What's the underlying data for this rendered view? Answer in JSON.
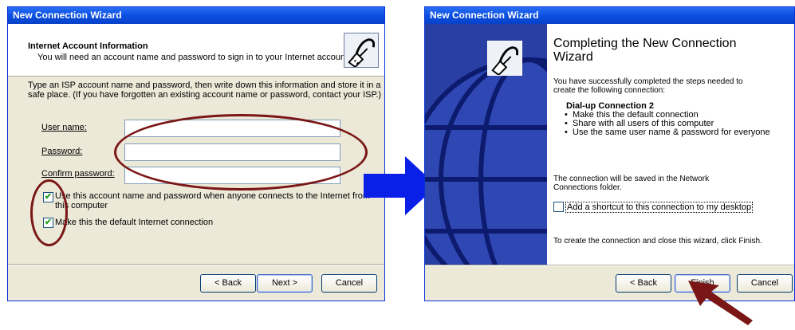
{
  "left_window": {
    "title": "New Connection Wizard",
    "header_title": "Internet Account Information",
    "header_subtitle": "You will need an account name and password to sign in to your Internet account.",
    "intro_line1": "Type an ISP account name and password, then write down this information and store it in a",
    "intro_line2": "safe place. (If you have forgotten an existing account name or password, contact your ISP.)",
    "username_label": "User name:",
    "username_value": "",
    "password_label": "Password:",
    "password_value": "",
    "confirm_label": "Confirm password:",
    "confirm_value": "",
    "check1_line1": "Use this account  name and password when anyone connects to the Internet from",
    "check1_line2": "this computer",
    "check1_checked": true,
    "check2_label": "Make this the default Internet connection",
    "check2_checked": true,
    "back_label": "< Back",
    "next_label": "Next >",
    "cancel_label": "Cancel"
  },
  "right_window": {
    "title": "New Connection Wizard",
    "heading_line1": "Completing the New Connection",
    "heading_line2": "Wizard",
    "body_line1": "You have successfully completed the steps needed to",
    "body_line2": "create the following connection:",
    "connection_name": "Dial-up Connection 2",
    "bullets": [
      "Make this the default connection",
      "Share with all users of this computer",
      "Use the same user name & password for everyone"
    ],
    "saved_line1": "The connection will be saved in the Network",
    "saved_line2": "Connections folder.",
    "shortcut_label": "Add a shortcut to this connection to my desktop",
    "shortcut_checked": false,
    "finish_instruction": "To create the connection and close this wizard, click Finish.",
    "back_label": "< Back",
    "finish_label": "Finish",
    "cancel_label": "Cancel"
  },
  "colors": {
    "title_bar": "#0a4fe0",
    "annotation": "#7a1716",
    "arrow_blue": "#0a1fe8"
  }
}
